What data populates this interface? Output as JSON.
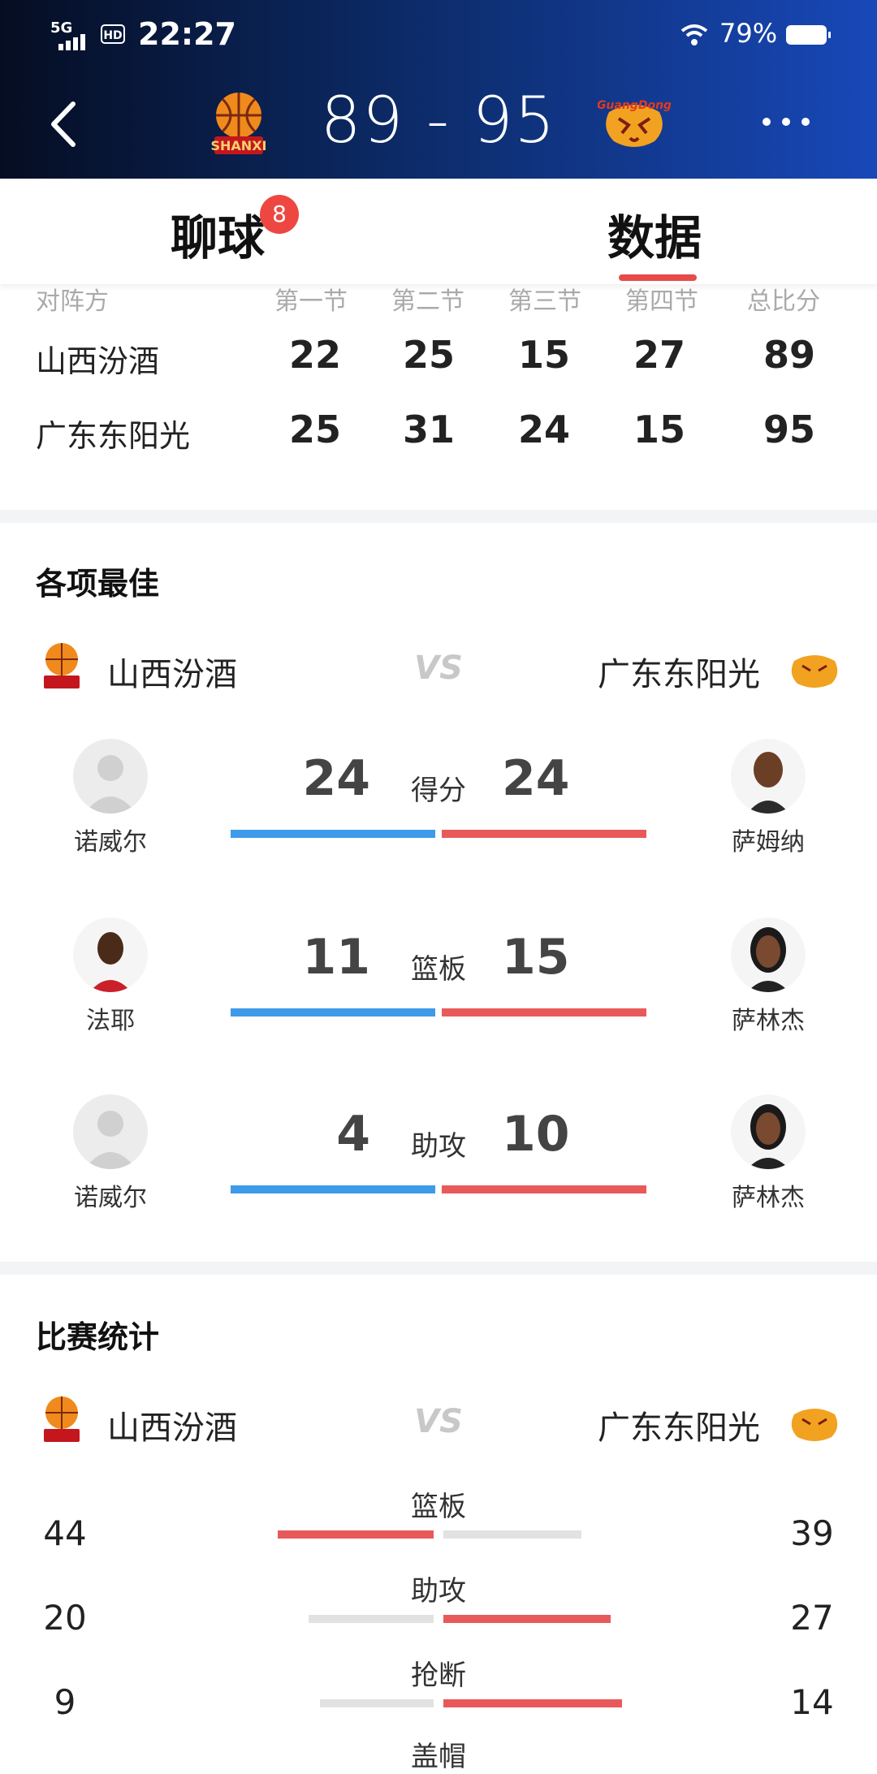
{
  "status_bar": {
    "network": "5G",
    "hd": "HD",
    "time": "22:27",
    "battery": "79%"
  },
  "header": {
    "score": "89 - 95",
    "home_logo_text": "SHANXI",
    "away_logo_text": "GuangDong"
  },
  "tabs": {
    "chat_label": "聊球",
    "chat_badge": "8",
    "data_label": "数据"
  },
  "quarters": {
    "headers": [
      "对阵方",
      "第一节",
      "第二节",
      "第三节",
      "第四节",
      "总比分"
    ],
    "rows": [
      {
        "team": "山西汾酒",
        "scores": [
          "22",
          "25",
          "15",
          "27",
          "89"
        ]
      },
      {
        "team": "广东东阳光",
        "scores": [
          "25",
          "31",
          "24",
          "15",
          "95"
        ]
      }
    ]
  },
  "leaders": {
    "title": "各项最佳",
    "home_team": "山西汾酒",
    "vs": "VS",
    "away_team": "广东东阳光",
    "items": [
      {
        "label": "得分",
        "home_player": "诺威尔",
        "home_value": "24",
        "away_player": "萨姆纳",
        "away_value": "24"
      },
      {
        "label": "篮板",
        "home_player": "法耶",
        "home_value": "11",
        "away_player": "萨林杰",
        "away_value": "15"
      },
      {
        "label": "助攻",
        "home_player": "诺威尔",
        "home_value": "4",
        "away_player": "萨林杰",
        "away_value": "10"
      }
    ]
  },
  "match_stats": {
    "title": "比赛统计",
    "home_team": "山西汾酒",
    "vs": "VS",
    "away_team": "广东东阳光",
    "items": [
      {
        "label": "篮板",
        "home": "44",
        "away": "39"
      },
      {
        "label": "助攻",
        "home": "20",
        "away": "27"
      },
      {
        "label": "抢断",
        "home": "9",
        "away": "14"
      },
      {
        "label": "盖帽"
      }
    ]
  },
  "colors": {
    "accent_red": "#e85a5a",
    "home_blue": "#3d9be9",
    "badge_red": "#ee4742"
  },
  "icons": {
    "back": "chevron-left-icon",
    "more": "more-dots-icon"
  }
}
